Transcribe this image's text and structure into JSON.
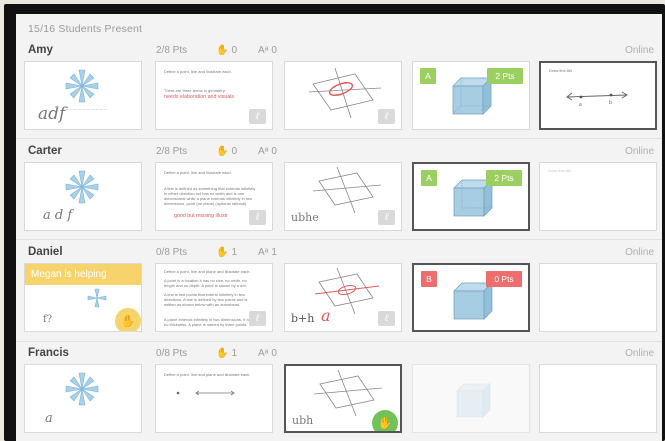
{
  "header": {
    "presence": "15/16 Students Present"
  },
  "colors": {
    "green": "#9ccf62",
    "red": "#ee6d6d",
    "yellow": "#f7d46b",
    "redInk": "#e05a5a"
  },
  "icons": {
    "hand": "raised-hand-icon",
    "ai": "letters-icon",
    "comment": "script-l-icon"
  },
  "students": [
    {
      "name": "Amy",
      "points": "2/8 Pts",
      "hands": "0",
      "ai": "0",
      "status": "Online",
      "handwriting": "adf",
      "doc": {
        "prompt": "Define a point, line and illustrate each.",
        "answer": "There are three terms in geometry.",
        "note": "needs elaboration and visuals"
      },
      "grade": {
        "letter": "A",
        "points": "2 Pts"
      },
      "draw_prompt": "Draw line AB"
    },
    {
      "name": "Carter",
      "points": "2/8 Pts",
      "hands": "0",
      "ai": "0",
      "status": "Online",
      "handwriting": "a d f",
      "doc": {
        "prompt": "Define a point, line and illustrate each.",
        "answer": [
          "A line is defined as something that extends infinitely",
          "in either direction but has no width and is one",
          "dimensional while a plane extends infinitely in two",
          "dimensions. point (no plane) (optional rational)"
        ],
        "note": "good but missing illustr"
      },
      "plane_text": "ubhe",
      "plane_mark": "e",
      "grade": {
        "letter": "A",
        "points": "2 Pts"
      },
      "draw_prompt": "Draw line AB"
    },
    {
      "name": "Daniel",
      "points": "0/8 Pts",
      "hands": "1",
      "ai": "1",
      "status": "Online",
      "helping": "Megan is helping",
      "handwriting": "f?",
      "doc": {
        "prompt": "Define a point, line and plane and illustrate each.",
        "answer": [
          "A point is a location it has no size, no width, no",
          "length and no depth. A point is shown by a dot.",
          "A line is two points that extend infinitely in two",
          "directions. A line is defined by two points and is",
          "written as shown below with an arrowhead.",
          "A plane extends infinitely in two dimensions. It has",
          "no thickness. A plane is named by three points."
        ]
      },
      "plane_text": "b+h",
      "plane_mark": "a",
      "grade": {
        "letter": "B",
        "points": "0 Pts"
      }
    },
    {
      "name": "Francis",
      "points": "0/8 Pts",
      "hands": "1",
      "ai": "0",
      "status": "Online",
      "handwriting": "a",
      "doc": {
        "prompt": "Define a point, line and plane and illustrate each."
      },
      "plane_text": "ubh"
    }
  ]
}
